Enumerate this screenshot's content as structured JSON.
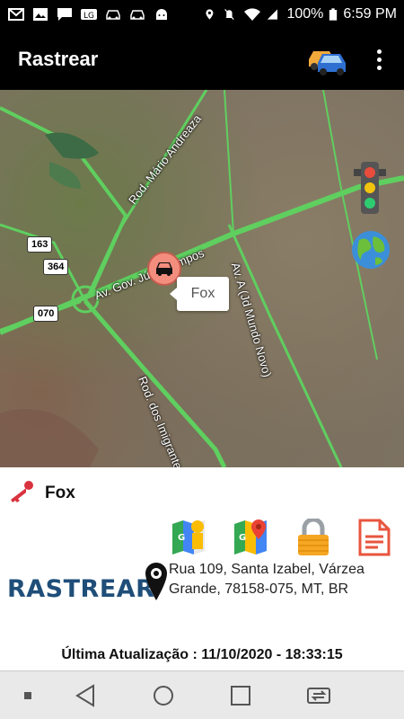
{
  "status_bar": {
    "battery_text": "100%",
    "time": "6:59 PM",
    "icons": [
      "gmail-icon",
      "gallery-icon",
      "message-icon",
      "lg-icon",
      "car-icon",
      "car-icon",
      "android-icon",
      "location-icon",
      "mute-icon",
      "wifi-icon",
      "signal-icon",
      "battery-icon"
    ]
  },
  "app_bar": {
    "title": "Rastrear",
    "icons": [
      "cars-icon",
      "more-vert-icon"
    ]
  },
  "map": {
    "labels": {
      "rod_mario": "Rod. Mário Andreaza",
      "av_gov": "Av. Gov. Júlio Campos",
      "av_a": "Av. A (Jd Mundo Novo)",
      "rod_imigrantes": "Rod. dos Imigrantes"
    },
    "shields": [
      "163",
      "364",
      "070"
    ],
    "info_window": "Fox",
    "icons": [
      "traffic-light-icon",
      "globe-icon",
      "car-marker-icon"
    ]
  },
  "panel": {
    "vehicle_name": "Fox",
    "brand": "RASTREAR",
    "address": "Rua 109, Santa Izabel, Várzea Grande, 78158-075, MT, BR",
    "update_label": "Última Atualização : 11/10/2020 - 18:33:15",
    "actions": [
      "street-view-icon",
      "google-maps-icon",
      "lock-icon",
      "document-icon"
    ]
  },
  "nav_bar": {
    "icons": [
      "dot-icon",
      "back-icon",
      "home-icon",
      "recents-icon",
      "switch-icon"
    ]
  },
  "colors": {
    "road": "#5fcf5f",
    "marker": "#f38d7e",
    "brand": "#1f4e79",
    "key": "#d9333f"
  }
}
